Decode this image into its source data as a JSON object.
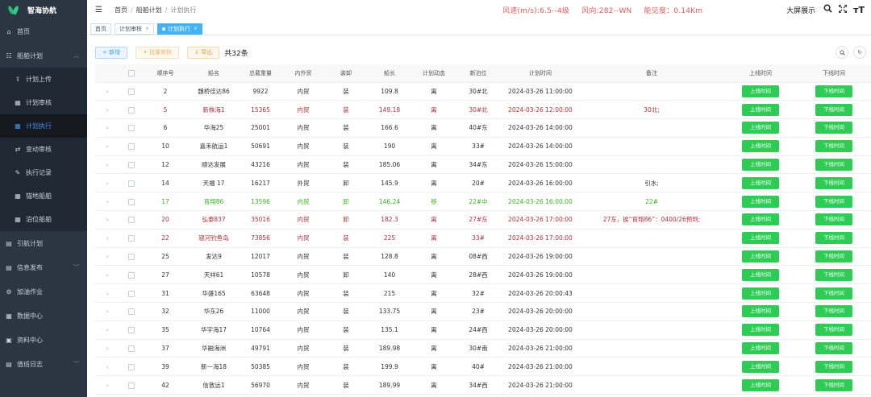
{
  "app": {
    "title": "智海协航"
  },
  "sidebar": {
    "items": [
      {
        "label": "首页",
        "icon": "home-icon"
      },
      {
        "label": "船舶计划",
        "icon": "list-icon",
        "expanded": true,
        "children": [
          {
            "label": "计划上传",
            "icon": "upload-icon"
          },
          {
            "label": "计划审核",
            "icon": "grid-icon"
          },
          {
            "label": "计划执行",
            "icon": "grid-icon",
            "active": true
          },
          {
            "label": "变动审核",
            "icon": "swap-icon"
          },
          {
            "label": "执行记录",
            "icon": "edit-icon"
          },
          {
            "label": "锚地船舶",
            "icon": "grid-icon"
          },
          {
            "label": "泊位船舶",
            "icon": "grid-icon"
          }
        ]
      },
      {
        "label": "引航计划",
        "icon": "document-icon"
      },
      {
        "label": "信息发布",
        "icon": "document-icon",
        "chevron": true
      },
      {
        "label": "加油作业",
        "icon": "gear-icon"
      },
      {
        "label": "数据中心",
        "icon": "grid-icon"
      },
      {
        "label": "资料中心",
        "icon": "folder-icon"
      },
      {
        "label": "值班日志",
        "icon": "document-icon",
        "chevron": true
      }
    ]
  },
  "header": {
    "breadcrumb": [
      "首页",
      "船舶计划",
      "计划执行"
    ],
    "wind_speed": "风速(m/s):6.5--4级",
    "wind_direction": "风向:282--WN",
    "visibility": "能见度：0.14Km",
    "big_screen": "大屏展示"
  },
  "tabs": [
    {
      "label": "首页",
      "closable": false,
      "active": false
    },
    {
      "label": "计划审核",
      "closable": true,
      "active": false
    },
    {
      "label": "计划执行",
      "closable": true,
      "active": true
    }
  ],
  "toolbar": {
    "add": "+ 新增",
    "batch": "✦ 批量审核",
    "export": "⇓ 导出",
    "total": "共32条"
  },
  "table": {
    "columns": [
      "",
      "",
      "顺序号",
      "船名",
      "总载重量",
      "内外贸",
      "装卸",
      "船长",
      "计划动态",
      "新泊位",
      "计划时间",
      "备注",
      "上线时间",
      "下线时间"
    ],
    "on_label": "上线时间",
    "off_label": "下线时间",
    "rows": [
      {
        "no": "2",
        "name": "魏桥佳达86",
        "dwt": "9922",
        "trade": "内贸",
        "load": "装",
        "length": "109.8",
        "dyn": "离",
        "berth": "30#北",
        "time": "2024-03-26 11:00:00",
        "note": "",
        "style": ""
      },
      {
        "no": "5",
        "name": "新株海1",
        "dwt": "15365",
        "trade": "内贸",
        "load": "装",
        "length": "149.18",
        "dyn": "离",
        "berth": "30#北",
        "time": "2024-03-26 12:00:00",
        "note": "30北;",
        "style": "red"
      },
      {
        "no": "6",
        "name": "华海25",
        "dwt": "25001",
        "trade": "内贸",
        "load": "装",
        "length": "166.6",
        "dyn": "离",
        "berth": "40#东",
        "time": "2024-03-26 14:00:00",
        "note": "",
        "style": ""
      },
      {
        "no": "10",
        "name": "嘉禾航运1",
        "dwt": "50691",
        "trade": "内贸",
        "load": "装",
        "length": "190",
        "dyn": "离",
        "berth": "33#",
        "time": "2024-03-26 14:00:00",
        "note": "",
        "style": ""
      },
      {
        "no": "12",
        "name": "顺达发展",
        "dwt": "43216",
        "trade": "内贸",
        "load": "装",
        "length": "185.06",
        "dyn": "离",
        "berth": "34#东",
        "time": "2024-03-26 15:00:00",
        "note": "",
        "style": ""
      },
      {
        "no": "14",
        "name": "天福 17",
        "dwt": "16217",
        "trade": "外贸",
        "load": "卸",
        "length": "145.9",
        "dyn": "离",
        "berth": "20#",
        "time": "2024-03-26 16:00:00",
        "note": "引水;",
        "style": ""
      },
      {
        "no": "17",
        "name": "育翔86",
        "dwt": "13596",
        "trade": "内贸",
        "load": "卸",
        "length": "146.24",
        "dyn": "移",
        "berth": "22#中",
        "time": "2024-03-26 16:00:00",
        "note": "22#",
        "style": "green"
      },
      {
        "no": "20",
        "name": "弘泰837",
        "dwt": "35016",
        "trade": "内贸",
        "load": "卸",
        "length": "182.3",
        "dyn": "离",
        "berth": "27#东",
        "time": "2024-03-26 17:00:00",
        "note": "27东，挨“育翔86”：0400/26预到;",
        "style": "red"
      },
      {
        "no": "22",
        "name": "银河钓鱼岛",
        "dwt": "73856",
        "trade": "内贸",
        "load": "装",
        "length": "225",
        "dyn": "离",
        "berth": "33#",
        "time": "2024-03-26 17:00:00",
        "note": "",
        "style": "red"
      },
      {
        "no": "25",
        "name": "发达9",
        "dwt": "12017",
        "trade": "内贸",
        "load": "装",
        "length": "128.8",
        "dyn": "离",
        "berth": "08#西",
        "time": "2024-03-26 19:00:00",
        "note": "",
        "style": ""
      },
      {
        "no": "27",
        "name": "天祥61",
        "dwt": "10578",
        "trade": "内贸",
        "load": "卸",
        "length": "140",
        "dyn": "离",
        "berth": "28#西",
        "time": "2024-03-26 19:00:00",
        "note": "",
        "style": ""
      },
      {
        "no": "31",
        "name": "华盛165",
        "dwt": "63648",
        "trade": "内贸",
        "load": "装",
        "length": "215",
        "dyn": "离",
        "berth": "32#",
        "time": "2024-03-26 20:00:43",
        "note": "",
        "style": ""
      },
      {
        "no": "32",
        "name": "华东26",
        "dwt": "11000",
        "trade": "内贸",
        "load": "装",
        "length": "133.75",
        "dyn": "离",
        "berth": "23#",
        "time": "2024-03-26 20:00:00",
        "note": "",
        "style": ""
      },
      {
        "no": "35",
        "name": "华宇海17",
        "dwt": "10764",
        "trade": "内贸",
        "load": "装",
        "length": "135.1",
        "dyn": "离",
        "berth": "24#西",
        "time": "2024-03-26 20:00:00",
        "note": "",
        "style": ""
      },
      {
        "no": "37",
        "name": "华融海洲",
        "dwt": "49791",
        "trade": "内贸",
        "load": "装",
        "length": "189.98",
        "dyn": "离",
        "berth": "30#南",
        "time": "2024-03-26 21:00:00",
        "note": "",
        "style": ""
      },
      {
        "no": "39",
        "name": "新一海18",
        "dwt": "50385",
        "trade": "内贸",
        "load": "装",
        "length": "199.9",
        "dyn": "离",
        "berth": "40#",
        "time": "2024-03-26 21:00:00",
        "note": "",
        "style": ""
      },
      {
        "no": "42",
        "name": "信敦远1",
        "dwt": "56970",
        "trade": "内贸",
        "load": "装",
        "length": "189.99",
        "dyn": "离",
        "berth": "34#西",
        "time": "2024-03-26 21:00:00",
        "note": "",
        "style": ""
      }
    ]
  }
}
